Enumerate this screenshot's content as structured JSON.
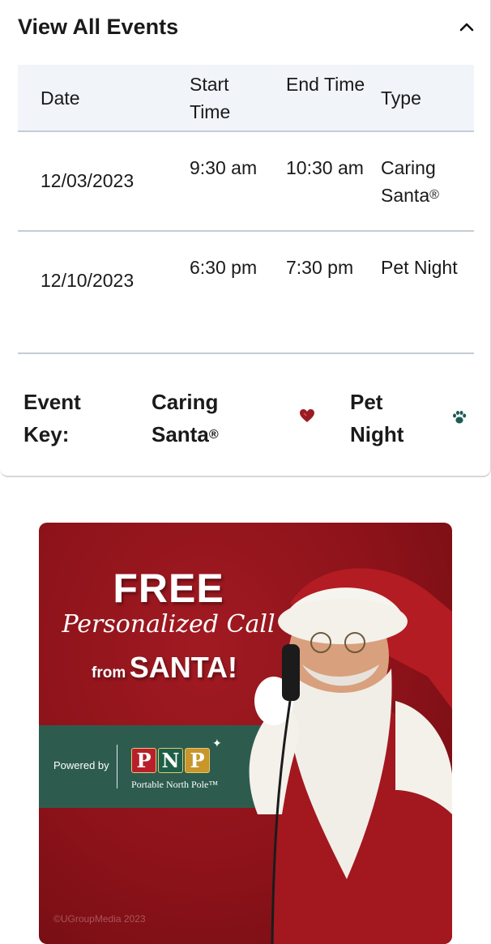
{
  "events": {
    "title": "View All Events",
    "columns": {
      "date": "Date",
      "start": "Start Time",
      "end": "End Time",
      "type": "Type"
    },
    "rows": [
      {
        "date": "12/03/2023",
        "start": "9:30 am",
        "end": "10:30 am",
        "type": "Caring Santa",
        "type_mark": "®"
      },
      {
        "date": "12/10/2023",
        "start": "6:30 pm",
        "end": "7:30 pm",
        "type": "Pet Night"
      }
    ],
    "key": {
      "label": "Event Key:",
      "santa_label": "Caring Santa",
      "santa_mark": "®",
      "pet_label": "Pet Night",
      "santa_icon": "heart-icon",
      "pet_icon": "paw-icon"
    }
  },
  "banner": {
    "headline": "FREE",
    "script": "Personalized Call",
    "from": "from",
    "santa": "SANTA!",
    "powered_by": "Powered by",
    "logo_letters": [
      "P",
      "N",
      "P"
    ],
    "logo_subtitle": "Portable North Pole™",
    "copyright": "©UGroupMedia 2023"
  },
  "colors": {
    "heart": "#9b1b24",
    "paw": "#1e5b55",
    "banner_red": "#8c1219",
    "band_green": "#2d5c4f"
  }
}
